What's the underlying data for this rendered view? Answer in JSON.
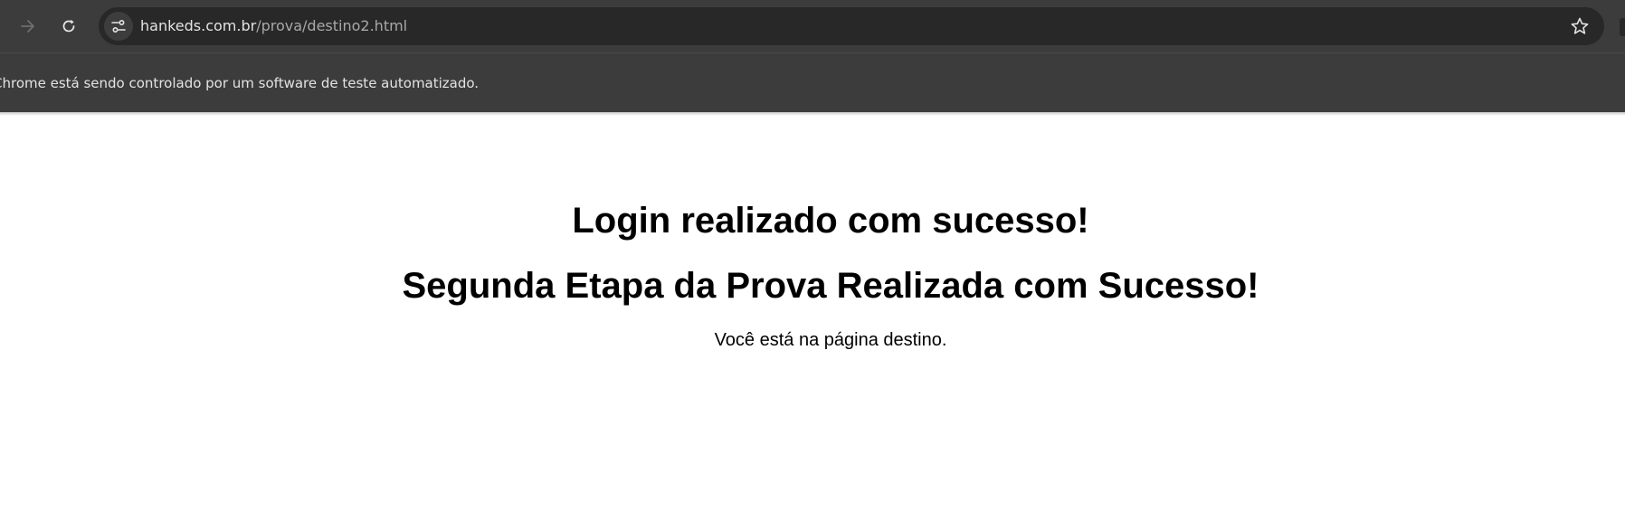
{
  "browser": {
    "address_bar": {
      "host": "hankeds.com.br",
      "path": "/prova/destino2.html"
    },
    "icons": {
      "forward": "arrow-right-icon",
      "reload": "reload-icon",
      "site_info": "tune-icon",
      "bookmark": "star-outline-icon"
    },
    "infobar": {
      "message": "Chrome está sendo controlado por um software de teste automatizado."
    },
    "colors": {
      "toolbar_bg": "#3c3c3c",
      "omnibox_bg": "#282828",
      "text": "#e3e3e3"
    }
  },
  "page": {
    "heading_primary": "Login realizado com sucesso!",
    "heading_secondary": "Segunda Etapa da Prova Realizada com Sucesso!",
    "message": "Você está na página destino."
  }
}
